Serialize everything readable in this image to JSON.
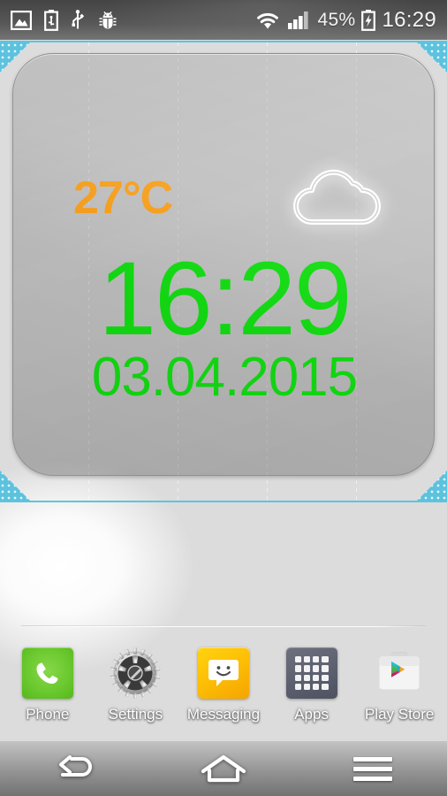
{
  "status_bar": {
    "left_icons": [
      {
        "name": "screenshot-icon",
        "label": "Screenshot"
      },
      {
        "name": "usb-battery-icon",
        "label": "USB charging"
      },
      {
        "name": "usb-icon",
        "label": "USB connected"
      },
      {
        "name": "debug-bug-icon",
        "label": "USB debugging"
      }
    ],
    "wifi_icon": "wifi-icon",
    "signal_icon": "cellular-signal-icon",
    "battery_percent": "45%",
    "battery_icon": "battery-charging-icon",
    "clock": "16:29"
  },
  "widget": {
    "selected": true,
    "selection_color": "#5cc2dd",
    "temperature": "27°C",
    "temperature_color": "#f9a01b",
    "weather_icon": "cloud-icon",
    "time": "16:29",
    "date": "03.04.2015",
    "clock_color": "#13e013"
  },
  "dock": {
    "items": [
      {
        "label": "Phone",
        "icon": "phone-icon",
        "color": "#6cc92f"
      },
      {
        "label": "Settings",
        "icon": "gear-icon",
        "color": "#9a9a9a"
      },
      {
        "label": "Messaging",
        "icon": "message-icon",
        "color": "#fdc006"
      },
      {
        "label": "Apps",
        "icon": "app-grid-icon",
        "color": "#5d6170"
      },
      {
        "label": "Play Store",
        "icon": "play-store-icon",
        "color": "#ffffff"
      }
    ]
  },
  "nav_bar": {
    "back": "back-icon",
    "home": "home-icon",
    "menu": "menu-icon"
  }
}
